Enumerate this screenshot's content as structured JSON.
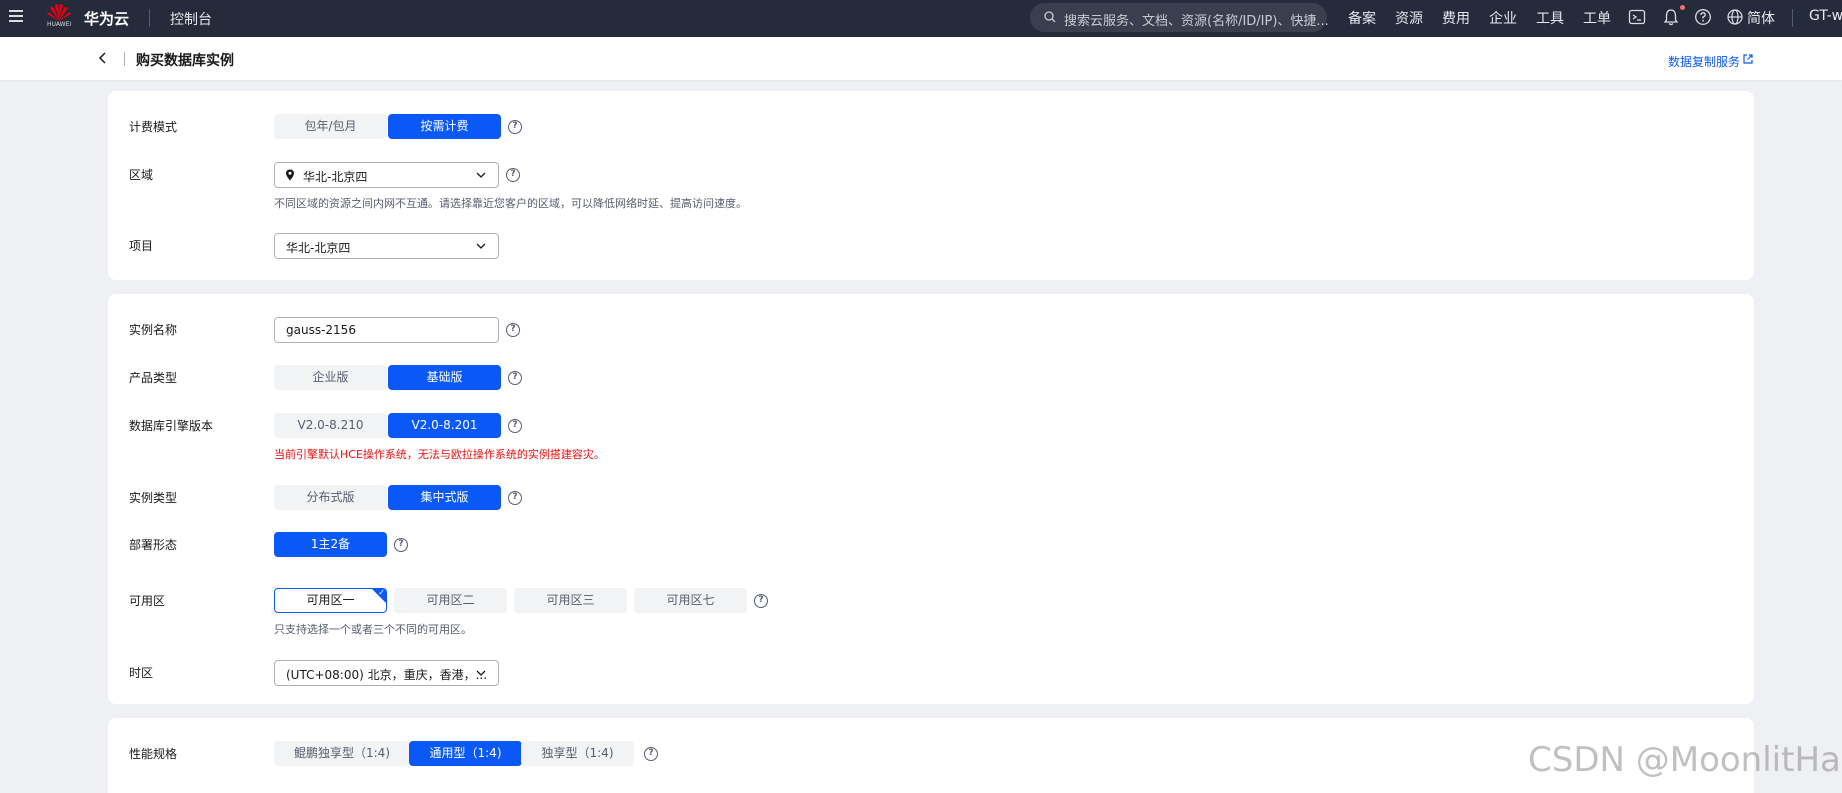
{
  "topbar": {
    "logo_text": "HUAWEI",
    "brand": "华为云",
    "console": "控制台",
    "search_placeholder": "搜索云服务、文档、资源(名称/ID/IP)、快捷...",
    "nav": [
      "备案",
      "资源",
      "费用",
      "企业",
      "工具",
      "工单"
    ],
    "language": "简体",
    "user": "GT-wh"
  },
  "subheader": {
    "title": "购买数据库实例",
    "link": "数据复制服务"
  },
  "billing": {
    "label": "计费模式",
    "options": [
      "包年/包月",
      "按需计费"
    ],
    "selected": "按需计费"
  },
  "region": {
    "label": "区域",
    "value": "华北-北京四",
    "hint": "不同区域的资源之间内网不互通。请选择靠近您客户的区域，可以降低网络时延、提高访问速度。"
  },
  "project": {
    "label": "项目",
    "value": "华北-北京四"
  },
  "instance_name": {
    "label": "实例名称",
    "value": "gauss-2156"
  },
  "product_type": {
    "label": "产品类型",
    "options": [
      "企业版",
      "基础版"
    ],
    "selected": "基础版"
  },
  "engine_version": {
    "label": "数据库引擎版本",
    "options": [
      "V2.0-8.210",
      "V2.0-8.201"
    ],
    "selected": "V2.0-8.201",
    "warning": "当前引擎默认HCE操作系统，无法与欧拉操作系统的实例搭建容灾。"
  },
  "instance_type": {
    "label": "实例类型",
    "options": [
      "分布式版",
      "集中式版"
    ],
    "selected": "集中式版"
  },
  "deployment": {
    "label": "部署形态",
    "options": [
      "1主2备"
    ],
    "selected": "1主2备"
  },
  "az": {
    "label": "可用区",
    "options": [
      "可用区一",
      "可用区二",
      "可用区三",
      "可用区七"
    ],
    "selected": "可用区一",
    "hint": "只支持选择一个或者三个不同的可用区。"
  },
  "timezone": {
    "label": "时区",
    "value": "(UTC+08:00) 北京，重庆，香港，..."
  },
  "performance": {
    "label": "性能规格",
    "options": [
      "鲲鹏独享型（1:4)",
      "通用型（1:4)",
      "独享型（1:4)"
    ],
    "selected": "通用型（1:4)"
  },
  "watermark": "CSDN @MoonlitHan",
  "colors": {
    "topbar": "#252b3a",
    "primary": "#0a59f7",
    "warning": "#ec0f0f",
    "page_bg": "#eff0f4"
  }
}
